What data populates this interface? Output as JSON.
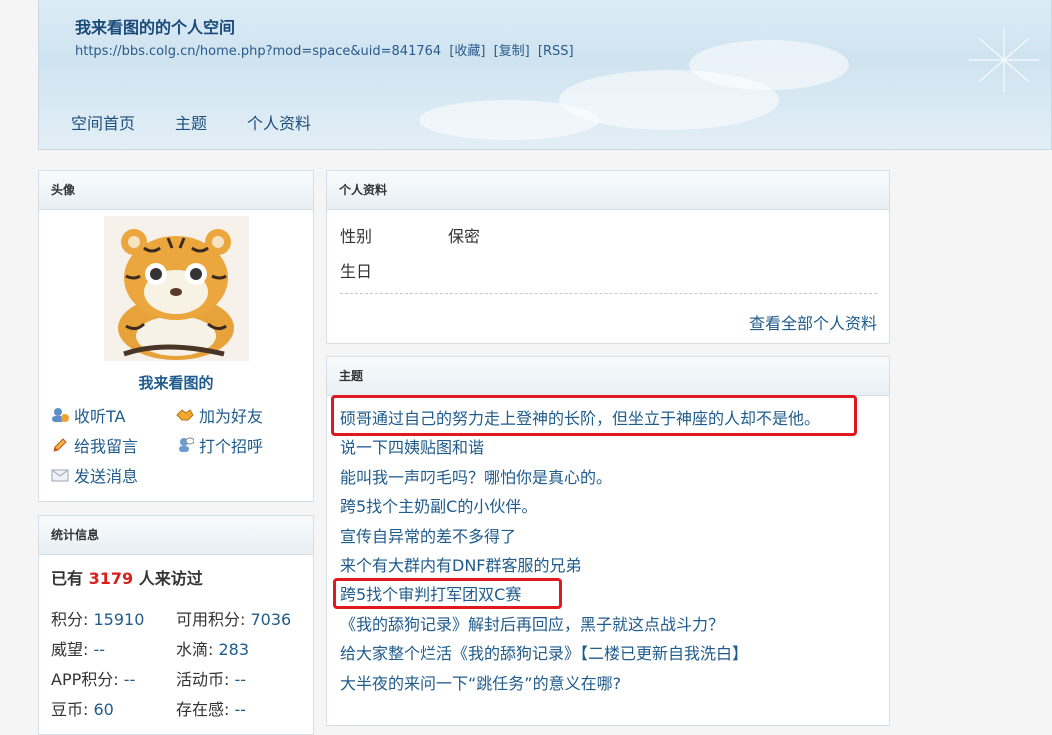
{
  "header": {
    "title": "我来看图的的个人空间",
    "url": "https://bbs.colg.cn/home.php?mod=space&uid=841764",
    "links": [
      "[收藏]",
      "[复制]",
      "[RSS]"
    ],
    "nav": [
      "空间首页",
      "主题",
      "个人资料"
    ]
  },
  "avatar_panel": {
    "heading": "头像",
    "username": "我来看图的",
    "actions": [
      {
        "label": "收听TA",
        "icon": "follow-icon"
      },
      {
        "label": "加为好友",
        "icon": "handshake-icon"
      },
      {
        "label": "给我留言",
        "icon": "pencil-icon"
      },
      {
        "label": "打个招呼",
        "icon": "greet-icon"
      },
      {
        "label": "发送消息",
        "icon": "envelope-icon"
      }
    ]
  },
  "stats_panel": {
    "heading": "统计信息",
    "visits_prefix": "已有",
    "visits_count": "3179",
    "visits_suffix": "人来访过",
    "items": [
      {
        "label": "积分:",
        "value": "15910"
      },
      {
        "label": "可用积分:",
        "value": "7036"
      },
      {
        "label": "威望:",
        "value": "--"
      },
      {
        "label": "水滴:",
        "value": "283"
      },
      {
        "label": "APP积分:",
        "value": "--"
      },
      {
        "label": "活动币:",
        "value": "--"
      },
      {
        "label": "豆币:",
        "value": "60"
      },
      {
        "label": "存在感:",
        "value": "--"
      }
    ]
  },
  "profile_panel": {
    "heading": "个人资料",
    "rows": [
      {
        "label": "性别",
        "value": "保密"
      },
      {
        "label": "生日",
        "value": ""
      }
    ],
    "view_all": "查看全部个人资料"
  },
  "topics_panel": {
    "heading": "主题",
    "topics": [
      "硕哥通过自己的努力走上登神的长阶，但坐立于神座的人却不是他。",
      "说一下四姨贴图和谐",
      "能叫我一声叼毛吗？哪怕你是真心的。",
      "跨5找个主奶副C的小伙伴。",
      "宣传自异常的差不多得了",
      "来个有大群内有DNF群客服的兄弟",
      "跨5找个审判打军团双C赛",
      "《我的舔狗记录》解封后再回应，黑子就这点战斗力？",
      "给大家整个烂活《我的舔狗记录》【二楼已更新自我洗白】",
      "大半夜的来问一下“跳任务”的意义在哪?"
    ]
  },
  "colors": {
    "link": "#1f5b8c",
    "highlight": "#e0191e",
    "visits_number": "#d9201b"
  }
}
